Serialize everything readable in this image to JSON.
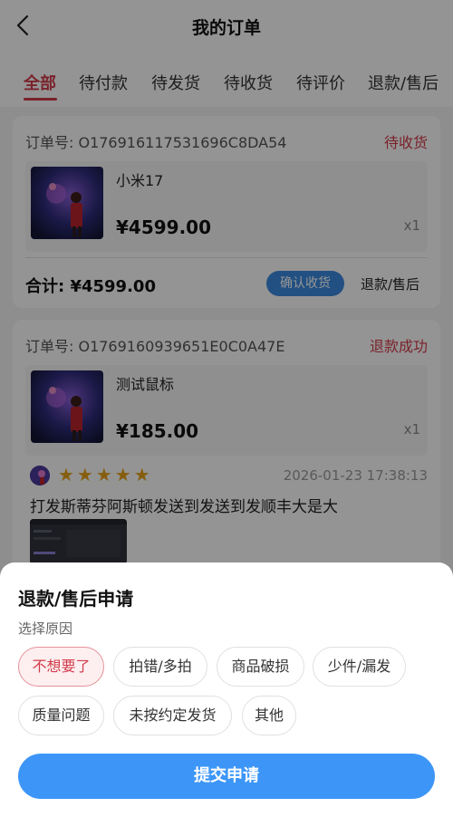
{
  "header": {
    "title": "我的订单"
  },
  "tabs": [
    {
      "label": "全部"
    },
    {
      "label": "待付款"
    },
    {
      "label": "待发货"
    },
    {
      "label": "待收货"
    },
    {
      "label": "待评价"
    },
    {
      "label": "退款/售后"
    }
  ],
  "orders": [
    {
      "order_no": "订单号: O176916117531696C8DA54",
      "status": "待收货",
      "product_name": "小米17",
      "price": "¥4599.00",
      "qty": "x1",
      "total": "合计: ¥4599.00",
      "confirm_label": "确认收货",
      "refund_label": "退款/售后"
    },
    {
      "order_no": "订单号: O1769160939651E0C0A47E",
      "status": "退款成功",
      "product_name": "测试鼠标",
      "price": "¥185.00",
      "qty": "x1",
      "review": {
        "stars": "★★★★★",
        "time": "2026-01-23 17:38:13",
        "text": "打发斯蒂芬阿斯顿发送到发送到发顺丰大是大"
      }
    }
  ],
  "sheet": {
    "title": "退款/售后申请",
    "subtitle": "选择原因",
    "reasons": [
      "不想要了",
      "拍错/多拍",
      "商品破损",
      "少件/漏发",
      "质量问题",
      "未按约定发货",
      "其他"
    ],
    "selected_reason": "不想要了",
    "submit_label": "提交申请"
  },
  "colors": {
    "accent_red": "#d23c4b",
    "accent_blue": "#3d96f7",
    "star": "#e5a21a"
  }
}
